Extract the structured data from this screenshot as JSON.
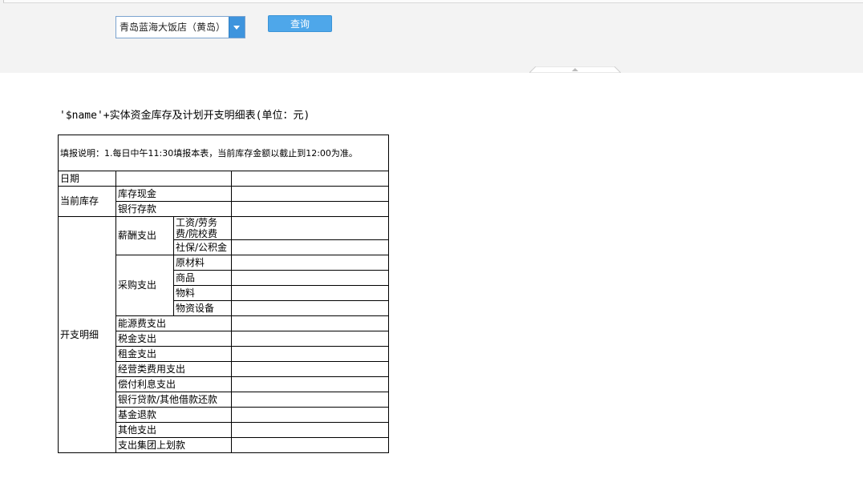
{
  "toolbar": {
    "hotel_select_value": "青岛蓝海大饭店（黄岛）",
    "query_label": "查询"
  },
  "report": {
    "title": "'$name'+实体资金库存及计划开支明细表(单位：元)",
    "note": "填报说明：1.每日中午11:30填报本表，当前库存金额以截止到12:00为准。",
    "date_label": "日期",
    "inventory": {
      "label": "当前库存",
      "rows": [
        "库存现金",
        "银行存款"
      ]
    },
    "expense": {
      "label": "开支明细",
      "salary": {
        "label": "薪酬支出",
        "rows": [
          "工资/劳务费/院校费",
          "社保/公积金"
        ]
      },
      "purchase": {
        "label": "采购支出",
        "rows": [
          "原材料",
          "商品",
          "物料",
          "物资设备"
        ]
      },
      "other_rows": [
        "能源费支出",
        "税金支出",
        "租金支出",
        "经营类费用支出",
        "偿付利息支出",
        "银行贷款/其他借款还款",
        "基金退款",
        "其他支出",
        "支出集团上划款"
      ]
    }
  }
}
